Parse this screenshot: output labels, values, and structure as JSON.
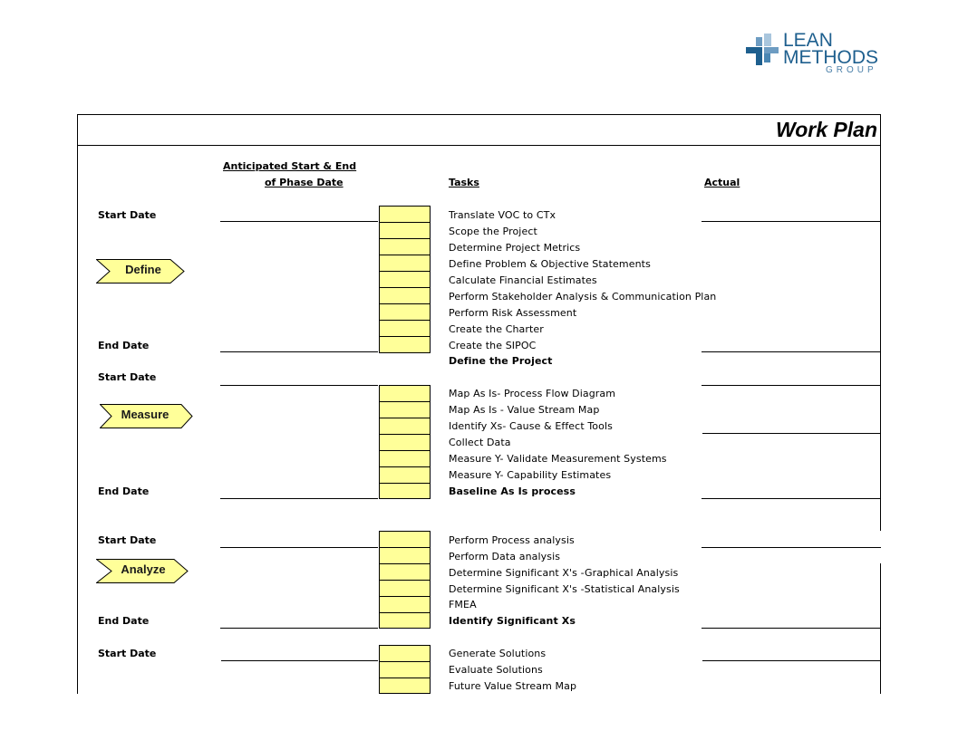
{
  "logo": {
    "line1": "LEAN",
    "line2": "METHODS",
    "line3": "GROUP",
    "colors": {
      "dark": "#1e5f8e",
      "light": "#8fb4d0"
    }
  },
  "title": "Work Plan",
  "headers": {
    "anticipated_line1": "Anticipated Start & End",
    "anticipated_line2": "of Phase Date",
    "tasks": "Tasks",
    "actual": "Actual"
  },
  "labels": {
    "start_date": "Start Date",
    "end_date": "End Date"
  },
  "phases": [
    {
      "name": "Define",
      "tasks": [
        "Translate VOC to CTx",
        "Scope the Project",
        "Determine Project Metrics",
        "Define Problem & Objective Statements",
        "Calculate Financial Estimates",
        "Perform Stakeholder Analysis & Communication Plan",
        "Perform Risk Assessment",
        "Create the Charter",
        "Create the SIPOC"
      ],
      "deliverable": "Define the Project"
    },
    {
      "name": "Measure",
      "tasks": [
        "Map As Is- Process Flow Diagram",
        "Map As Is - Value Stream Map",
        "Identify Xs- Cause & Effect Tools",
        "Collect Data",
        "Measure Y- Validate Measurement Systems",
        "Measure Y- Capability Estimates"
      ],
      "deliverable": "Baseline As Is process"
    },
    {
      "name": "Analyze",
      "tasks": [
        "Perform Process  analysis",
        "Perform Data analysis",
        "Determine Significant X's -Graphical Analysis",
        "Determine Significant X's -Statistical Analysis",
        "FMEA"
      ],
      "deliverable": "Identify Significant Xs"
    },
    {
      "name": "",
      "tasks": [
        "Generate Solutions",
        "Evaluate Solutions",
        "Future Value Stream Map"
      ],
      "deliverable": ""
    }
  ],
  "colors": {
    "cell_fill": "#ffff99",
    "arrow_fill": "#ffff99"
  }
}
